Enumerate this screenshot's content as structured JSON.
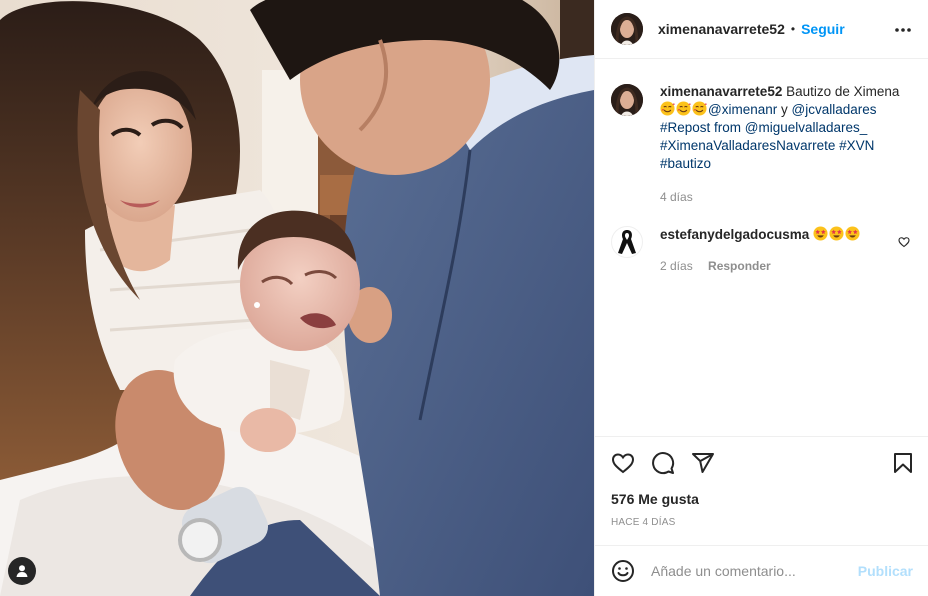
{
  "post": {
    "author": {
      "username": "ximenanavarrete52"
    },
    "header": {
      "separator": "•",
      "follow_label": "Seguir",
      "more_icon": "more-horizontal-icon"
    },
    "caption": {
      "username": "ximenanavarrete52",
      "text_start": "Bautizo de Ximena",
      "emojis": [
        "smiling-face-with-hearts",
        "smiling-face-with-hearts",
        "smiling-face-with-hearts"
      ],
      "mention_1": "@ximenanr",
      "connector": " y ",
      "mention_2": "@jcvalladares",
      "repost_prefix": "#Repost from ",
      "mention_3": "@miguelvalladares_",
      "hashtag_1": "#XimenaValladaresNavarrete",
      "hashtag_2": "#XVN",
      "hashtag_3": "#bautizo",
      "time": "4 días"
    },
    "comments": [
      {
        "username": "estefanydelgadocusma",
        "emojis": [
          "star-struck",
          "star-struck",
          "star-struck"
        ],
        "time": "2 días",
        "reply_label": "Responder",
        "avatar_icon": "black-ribbon-icon"
      }
    ],
    "actions": {
      "like_icon": "heart-icon",
      "comment_icon": "comment-icon",
      "share_icon": "paper-plane-icon",
      "save_icon": "bookmark-icon"
    },
    "likes_text": "576 Me gusta",
    "posted_ago": "HACE 4 DÍAS",
    "add_comment": {
      "placeholder": "Añade un comentario...",
      "value": "",
      "publish_label": "Publicar",
      "emoji_icon": "smiley-icon"
    },
    "media": {
      "tag_icon": "user-tag-icon"
    }
  },
  "colors": {
    "accent": "#0095f6",
    "publish_disabled": "#b2dffc",
    "text_primary": "#262626",
    "text_secondary": "#8e8e8e",
    "link": "#00376b",
    "divider": "#efefef"
  }
}
